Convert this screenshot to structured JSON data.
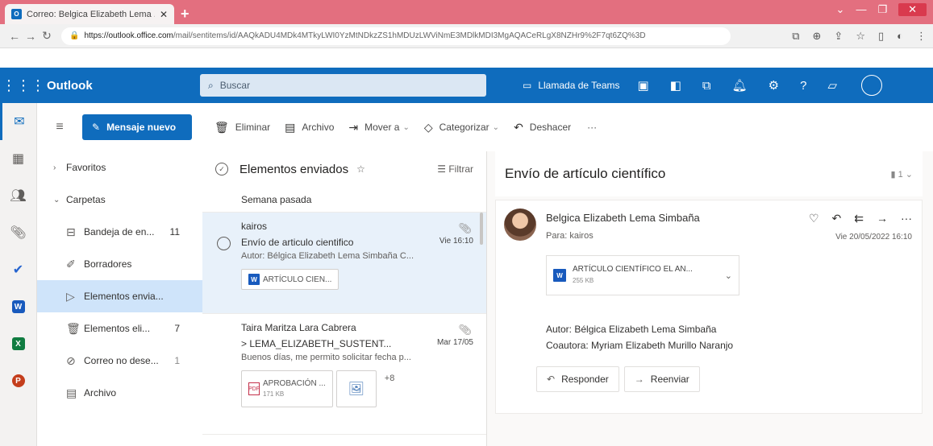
{
  "browser": {
    "tab_title": "Correo: Belgica Elizabeth Lema ...",
    "new_tab": "+",
    "url_host": "https://outlook.office.com",
    "url_path": "/mail/sentitems/id/AAQkADU4MDk4MTkyLWI0YzMtNDkzZS1hMDUzLWViNmE3MDlkMDI3MgAQACeRLgX8NZHr9%2F7qt6ZQ%3D"
  },
  "outlook": {
    "brand": "Outlook",
    "search_placeholder": "Buscar",
    "teams_call": "Llamada de Teams"
  },
  "toolbar": {
    "new_message": "Mensaje nuevo",
    "delete": "Eliminar",
    "archive": "Archivo",
    "move_to": "Mover a",
    "categorize": "Categorizar",
    "undo": "Deshacer",
    "more": "···"
  },
  "folders": {
    "favorites": "Favoritos",
    "folders_label": "Carpetas",
    "items": [
      {
        "label": "Bandeja de en...",
        "count": "11"
      },
      {
        "label": "Borradores",
        "count": ""
      },
      {
        "label": "Elementos envia...",
        "count": ""
      },
      {
        "label": "Elementos eli...",
        "count": "7"
      },
      {
        "label": "Correo no dese...",
        "count": "1"
      },
      {
        "label": "Archivo",
        "count": ""
      }
    ]
  },
  "message_list": {
    "title": "Elementos enviados",
    "filter": "Filtrar",
    "group": "Semana pasada",
    "messages": [
      {
        "from": "kairos",
        "subject": "Envío de articulo cientifico",
        "date": "Vie 16:10",
        "preview": "Autor: Bélgica Elizabeth Lema Simbaña C...",
        "attachment": "ARTÍCULO CIEN..."
      },
      {
        "from": "Taira Maritza Lara Cabrera",
        "subject": "> LEMA_ELIZABETH_SUSTENT...",
        "date": "Mar 17/05",
        "preview": "Buenos días, me permito solicitar fecha p...",
        "attachment": "APROBACIÓN ...",
        "attachment_size": "171 KB",
        "more": "+8"
      }
    ]
  },
  "reading": {
    "subject": "Envío de artículo científico",
    "count": "1",
    "sender": "Belgica Elizabeth Lema Simbaña",
    "to_label": "Para:",
    "to": "kairos",
    "date": "Vie 20/05/2022 16:10",
    "attachment_name": "ARTÍCULO CIENTÍFICO EL AN...",
    "attachment_size": "255 KB",
    "body_line1": "Autor: Bélgica Elizabeth Lema Simbaña",
    "body_line2": "Coautora: Myriam Elizabeth Murillo Naranjo",
    "reply": "Responder",
    "forward": "Reenviar"
  }
}
